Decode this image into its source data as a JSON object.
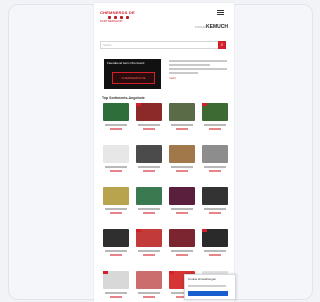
{
  "header": {
    "brand_name": "CHEMNERDS DE",
    "brand_sub": "PARTNERSHOP",
    "partner_prefix": "FORUM",
    "partner_name": "KEMUCH"
  },
  "search": {
    "placeholder": "Suche"
  },
  "banner": {
    "top_text": "Feierabend beim Chemnerd",
    "stamp_text": "CHEMNERDS.DE"
  },
  "blurb": {
    "link_text": "mehr"
  },
  "section": {
    "title": "Top Sortiments-Angebote"
  },
  "products": [
    {
      "color": "#2e6e3a",
      "badge": false
    },
    {
      "color": "#8c2a2a",
      "badge": true
    },
    {
      "color": "#5a6b48",
      "badge": false
    },
    {
      "color": "#3d6a32",
      "badge": true
    },
    {
      "color": "#e7e7e7",
      "badge": false
    },
    {
      "color": "#4b4b4b",
      "badge": false
    },
    {
      "color": "#a0784a",
      "badge": false
    },
    {
      "color": "#8d8d8d",
      "badge": false
    },
    {
      "color": "#b9a44e",
      "badge": false
    },
    {
      "color": "#3b7a50",
      "badge": false
    },
    {
      "color": "#5a1f3c",
      "badge": false
    },
    {
      "color": "#333333",
      "badge": false
    },
    {
      "color": "#2f2f2f",
      "badge": false
    },
    {
      "color": "#c23a3a",
      "badge": true
    },
    {
      "color": "#7b2530",
      "badge": false
    },
    {
      "color": "#2a2a2a",
      "badge": true
    },
    {
      "color": "#d8d8d8",
      "badge": true
    },
    {
      "color": "#cc6d6d",
      "badge": false
    },
    {
      "color": "#d73535",
      "badge": true
    },
    {
      "color": "#e3e3e3",
      "badge": false
    }
  ],
  "cookie": {
    "title": "Cookie Einstellungen"
  }
}
